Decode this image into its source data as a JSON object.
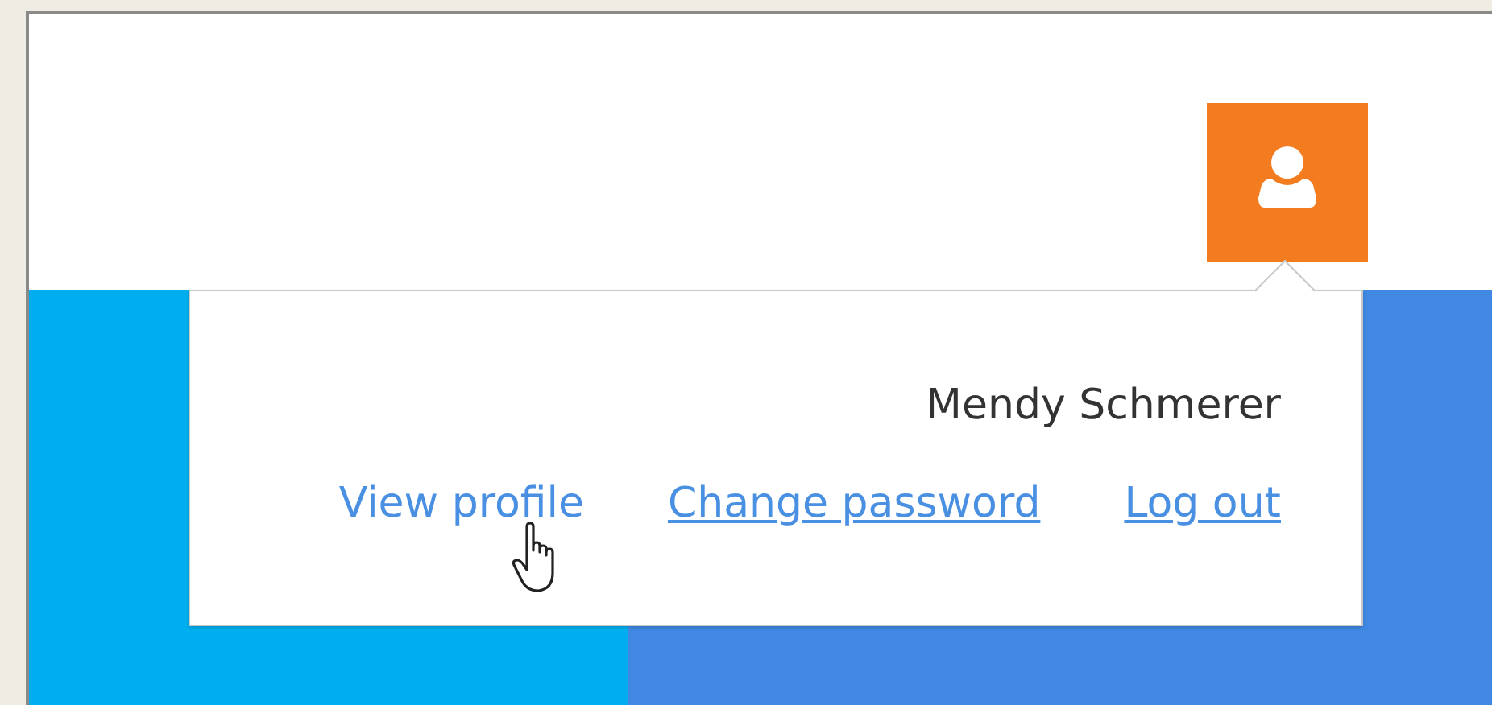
{
  "user_menu": {
    "name": "Mendy Schmerer",
    "links": [
      {
        "label": "View profile",
        "hovered": true
      },
      {
        "label": "Change password",
        "hovered": false
      },
      {
        "label": "Log out",
        "hovered": false
      }
    ]
  }
}
